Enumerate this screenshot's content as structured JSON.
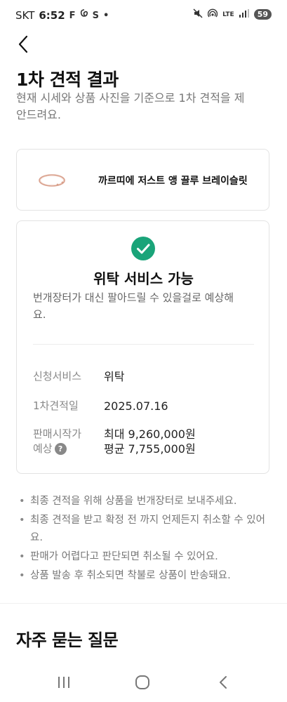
{
  "status_bar": {
    "carrier": "SKT",
    "time": "6:52",
    "notification_icons": [
      "F",
      "ණ",
      "S",
      "•"
    ],
    "network": "LTE",
    "battery": "59"
  },
  "header": {
    "title": "1차 견적 결과",
    "description": "현재 시세와 상품 사진을 기준으로 1차 견적을 제안드려요."
  },
  "product": {
    "name": "까르띠에 저스트 앵 끌루 브레이슬릿",
    "thumbnail_icon": "bracelet-image"
  },
  "result": {
    "status_icon": "check-circle-icon",
    "status_color": "#1aa479",
    "title": "위탁 서비스 가능",
    "description": "번개장터가 대신 팔아드릴 수 있을걸로 예상해요.",
    "rows": [
      {
        "label": "신청서비스",
        "value": "위탁"
      },
      {
        "label": "1차견적일",
        "value": "2025.07.16"
      }
    ],
    "price": {
      "label_line1": "판매시작가",
      "label_line2": "예상",
      "help_icon_text": "?",
      "max": "최대 9,260,000원",
      "avg": "평균 7,755,000원"
    }
  },
  "notes": [
    "최종 견적을 위해 상품을 번개장터로 보내주세요.",
    "최종 견적을 받고 확정 전 까지 언제든지 취소할 수 있어요.",
    "판매가 어렵다고 판단되면 취소될 수 있어요.",
    "상품 발송 후 취소되면 착불로 상품이 반송돼요."
  ],
  "faq": {
    "title": "자주 묻는 질문"
  }
}
